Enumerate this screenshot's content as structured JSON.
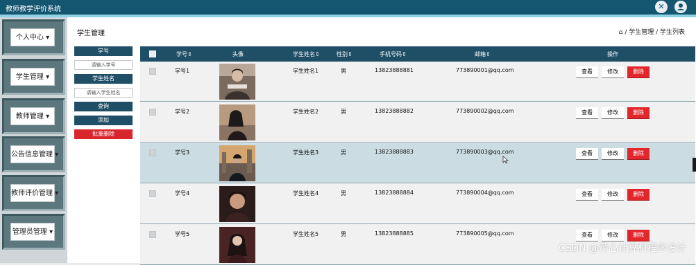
{
  "app": {
    "title": "教师教学评价系统"
  },
  "topbar": {
    "tool_icon": "crossed-tools-icon",
    "user_icon": "user-icon"
  },
  "sidebar": {
    "items": [
      {
        "label": "个人中心 ▾"
      },
      {
        "label": "学生管理 ▾"
      },
      {
        "label": "教师管理 ▾"
      },
      {
        "label": "公告信息管理 ▾"
      },
      {
        "label": "教师评价管理 ▾"
      },
      {
        "label": "管理员管理 ▾"
      }
    ]
  },
  "page": {
    "title": "学生管理",
    "breadcrumb": "/ 学生管理 / 学生列表"
  },
  "search": {
    "id_label": "学号",
    "id_placeholder": "请输入学号",
    "name_label": "学生姓名",
    "name_placeholder": "请输入学生姓名",
    "query": "查询",
    "add": "添加",
    "batch_delete": "批量删除"
  },
  "table": {
    "columns": [
      "学号⇕",
      "头像",
      "学生姓名⇕",
      "性别⇕",
      "手机号码⇕",
      "邮箱⇕",
      "操作"
    ],
    "actions": {
      "view": "查看",
      "edit": "修改",
      "delete": "删除"
    },
    "rows": [
      {
        "id": "学号1",
        "name": "学生姓名1",
        "gender": "男",
        "phone": "13823888881",
        "email": "773890001@qq.com"
      },
      {
        "id": "学号2",
        "name": "学生姓名2",
        "gender": "男",
        "phone": "13823888882",
        "email": "773890002@qq.com"
      },
      {
        "id": "学号3",
        "name": "学生姓名3",
        "gender": "男",
        "phone": "13823888883",
        "email": "773890003@qq.com"
      },
      {
        "id": "学号4",
        "name": "学生姓名4",
        "gender": "男",
        "phone": "13823888884",
        "email": "773890004@qq.com"
      },
      {
        "id": "学号5",
        "name": "学生姓名5",
        "gender": "男",
        "phone": "13823888885",
        "email": "773890005@qq.com"
      }
    ]
  },
  "watermark": "CSDN @芹心计算机程序设计",
  "colors": {
    "header": "#14556f",
    "accent_line": "#8fd2e5",
    "table_header": "#1f4f66",
    "danger": "#e1262c",
    "sidebar_tile": "#5d777f"
  }
}
